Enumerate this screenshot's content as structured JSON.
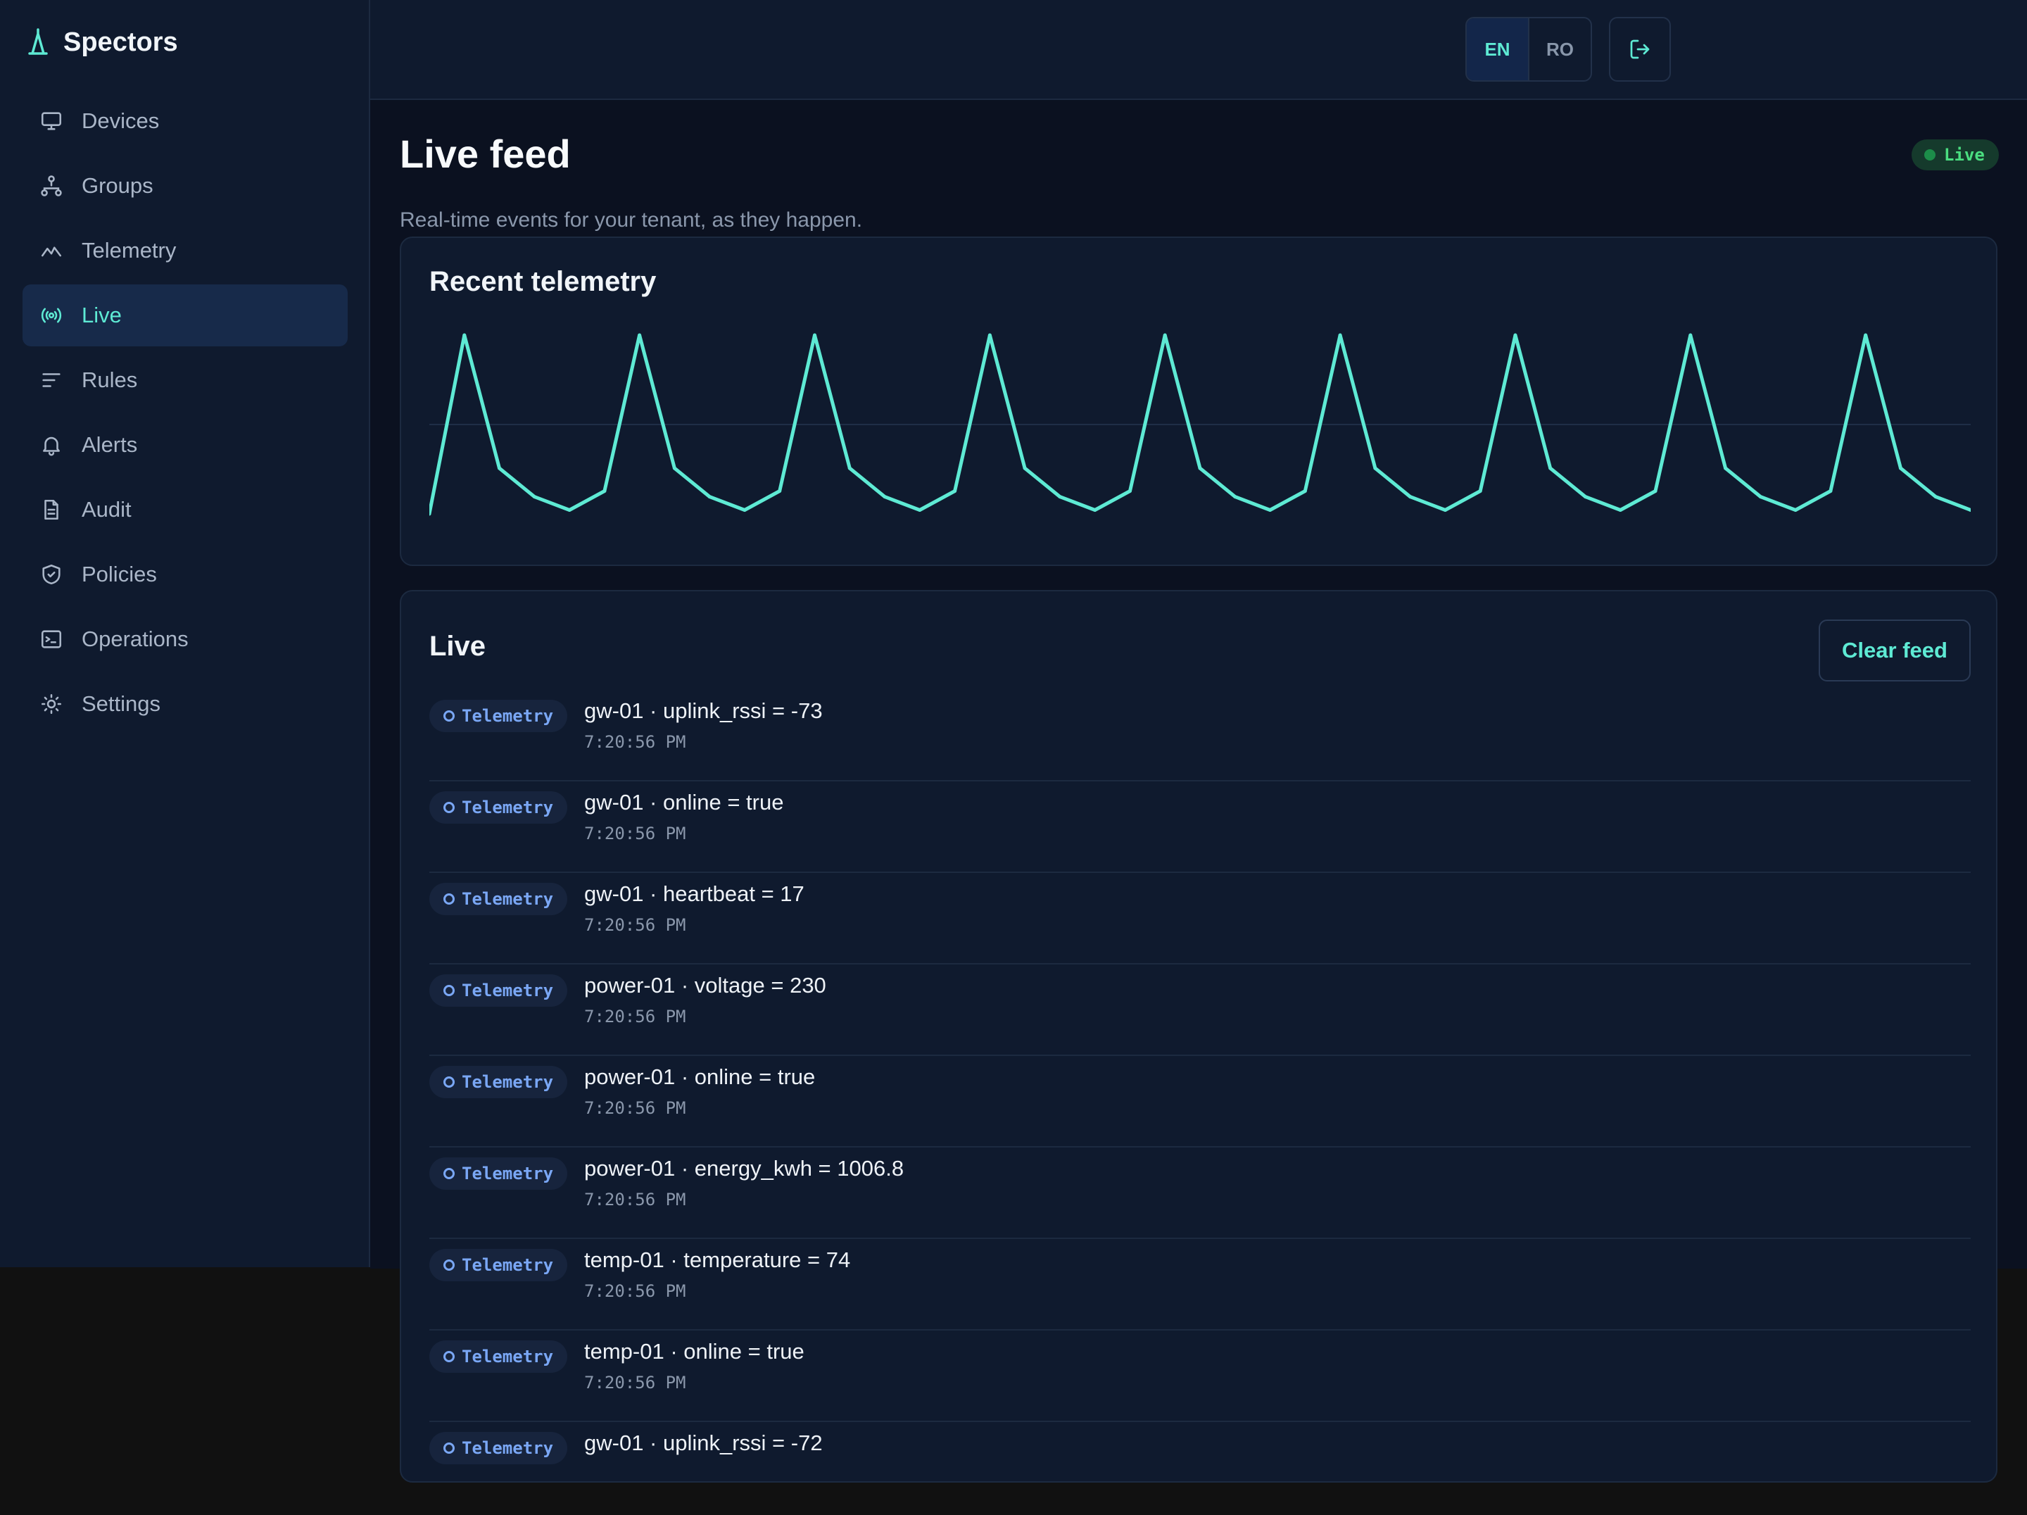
{
  "app": {
    "name": "Spectors"
  },
  "sidebar": {
    "items": [
      {
        "label": "Devices",
        "icon": "monitor-icon",
        "active": false
      },
      {
        "label": "Groups",
        "icon": "hierarchy-icon",
        "active": false
      },
      {
        "label": "Telemetry",
        "icon": "activity-icon",
        "active": false
      },
      {
        "label": "Live",
        "icon": "broadcast-icon",
        "active": true
      },
      {
        "label": "Rules",
        "icon": "lines-icon",
        "active": false
      },
      {
        "label": "Alerts",
        "icon": "bell-icon",
        "active": false
      },
      {
        "label": "Audit",
        "icon": "document-icon",
        "active": false
      },
      {
        "label": "Policies",
        "icon": "shield-icon",
        "active": false
      },
      {
        "label": "Operations",
        "icon": "terminal-icon",
        "active": false
      },
      {
        "label": "Settings",
        "icon": "sun-icon",
        "active": false
      }
    ]
  },
  "topbar": {
    "lang_en": "EN",
    "lang_ro": "RO",
    "logout_icon": "logout-icon"
  },
  "page": {
    "title": "Live feed",
    "badge": "Live",
    "subtitle": "Real-time events for your tenant, as they happen."
  },
  "chart": {
    "title": "Recent telemetry"
  },
  "chart_data": {
    "type": "line",
    "title": "Recent telemetry",
    "xlabel": "",
    "ylabel": "",
    "grid": true,
    "color": "#5eead4",
    "values": [
      0.03,
      0.97,
      0.27,
      0.12,
      0.05,
      0.15,
      0.97,
      0.27,
      0.12,
      0.05,
      0.15,
      0.97,
      0.27,
      0.12,
      0.05,
      0.15,
      0.97,
      0.27,
      0.12,
      0.05,
      0.15,
      0.97,
      0.27,
      0.12,
      0.05,
      0.15,
      0.97,
      0.27,
      0.12,
      0.05,
      0.15,
      0.97,
      0.27,
      0.12,
      0.05,
      0.15,
      0.97,
      0.27,
      0.12,
      0.05,
      0.15,
      0.97,
      0.27,
      0.12,
      0.05
    ]
  },
  "live": {
    "title": "Live",
    "clear_label": "Clear feed",
    "rows": [
      {
        "tag": "Telemetry",
        "text": "gw-01 · uplink_rssi = -73",
        "time": "7:20:56 PM"
      },
      {
        "tag": "Telemetry",
        "text": "gw-01 · online = true",
        "time": "7:20:56 PM"
      },
      {
        "tag": "Telemetry",
        "text": "gw-01 · heartbeat = 17",
        "time": "7:20:56 PM"
      },
      {
        "tag": "Telemetry",
        "text": "power-01 · voltage = 230",
        "time": "7:20:56 PM"
      },
      {
        "tag": "Telemetry",
        "text": "power-01 · online = true",
        "time": "7:20:56 PM"
      },
      {
        "tag": "Telemetry",
        "text": "power-01 · energy_kwh = 1006.8",
        "time": "7:20:56 PM"
      },
      {
        "tag": "Telemetry",
        "text": "temp-01 · temperature = 74",
        "time": "7:20:56 PM"
      },
      {
        "tag": "Telemetry",
        "text": "temp-01 · online = true",
        "time": "7:20:56 PM"
      },
      {
        "tag": "Telemetry",
        "text": "gw-01 · uplink_rssi = -72",
        "time": ""
      }
    ]
  }
}
